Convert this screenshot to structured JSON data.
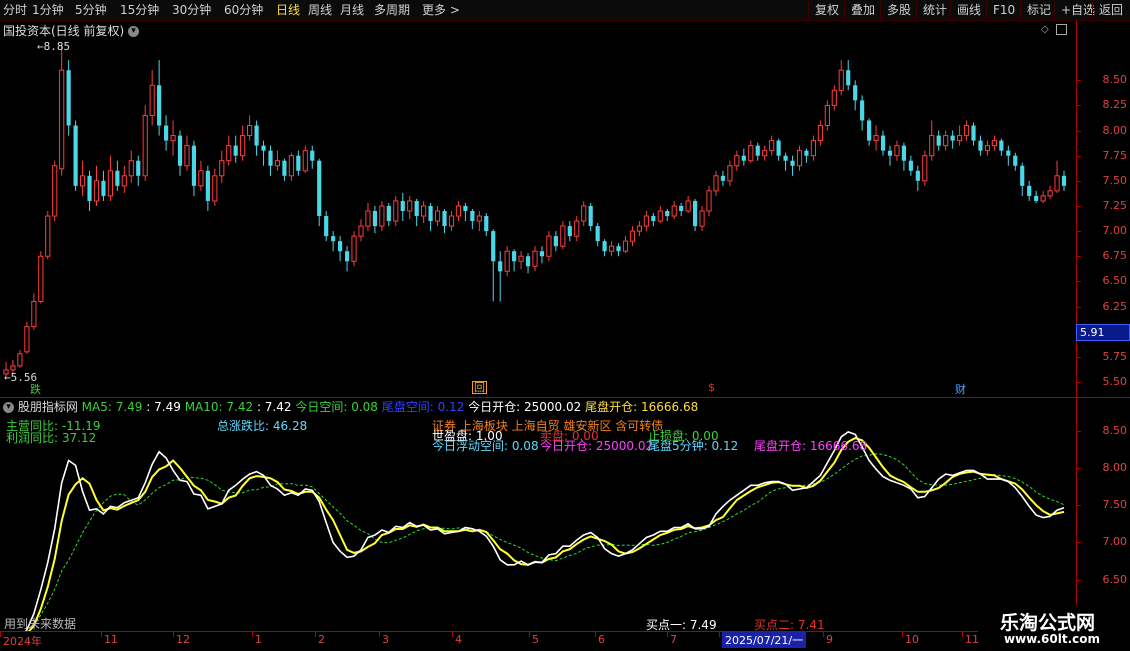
{
  "toolbar": {
    "periods": [
      "分时",
      "1分钟",
      "5分钟",
      "15分钟",
      "30分钟",
      "60分钟",
      "日线",
      "周线",
      "月线",
      "多周期",
      "更多 >"
    ],
    "active_period": "日线",
    "actions": [
      "复权",
      "叠加",
      "多股",
      "统计",
      "画线",
      "F10",
      "标记",
      "+自选",
      "返回"
    ]
  },
  "main": {
    "title": "国投资本(日线 前复权)",
    "high_label": "8.85",
    "low_label": "5.56",
    "current_price": "5.91",
    "yticks": [
      "8.50",
      "8.25",
      "8.00",
      "7.75",
      "7.50",
      "7.25",
      "7.00",
      "6.75",
      "6.50",
      "6.25",
      "6.00",
      "5.75",
      "5.50"
    ],
    "markers": [
      {
        "label": "跌",
        "color": "#3cd03c"
      },
      {
        "label": "回",
        "color": "#f0a020"
      },
      {
        "label": "$",
        "color": "#e03030"
      },
      {
        "label": "财",
        "color": "#4aa0ff"
      }
    ],
    "candles": [
      [
        5.62,
        5.58,
        5.7,
        5.55
      ],
      [
        5.66,
        5.62,
        5.72,
        5.58
      ],
      [
        5.78,
        5.66,
        5.82,
        5.64
      ],
      [
        6.05,
        5.8,
        6.1,
        5.78
      ],
      [
        6.3,
        6.05,
        6.38,
        6.02
      ],
      [
        6.75,
        6.3,
        6.8,
        6.28
      ],
      [
        7.15,
        6.75,
        7.2,
        6.72
      ],
      [
        7.65,
        7.15,
        7.7,
        7.1
      ],
      [
        8.6,
        7.62,
        8.85,
        7.55
      ],
      [
        8.05,
        8.6,
        8.7,
        7.95
      ],
      [
        7.45,
        8.05,
        8.1,
        7.4
      ],
      [
        7.55,
        7.45,
        7.7,
        7.35
      ],
      [
        7.3,
        7.55,
        7.6,
        7.2
      ],
      [
        7.5,
        7.3,
        7.65,
        7.25
      ],
      [
        7.35,
        7.5,
        7.6,
        7.3
      ],
      [
        7.6,
        7.35,
        7.75,
        7.3
      ],
      [
        7.45,
        7.6,
        7.7,
        7.4
      ],
      [
        7.55,
        7.45,
        7.65,
        7.38
      ],
      [
        7.7,
        7.55,
        7.8,
        7.48
      ],
      [
        7.55,
        7.7,
        7.75,
        7.45
      ],
      [
        8.15,
        7.55,
        8.25,
        7.5
      ],
      [
        8.45,
        8.15,
        8.6,
        8.05
      ],
      [
        8.05,
        8.45,
        8.7,
        7.95
      ],
      [
        7.9,
        8.05,
        8.15,
        7.8
      ],
      [
        7.95,
        7.9,
        8.1,
        7.75
      ],
      [
        7.65,
        7.95,
        8.0,
        7.55
      ],
      [
        7.85,
        7.65,
        7.95,
        7.6
      ],
      [
        7.45,
        7.85,
        7.9,
        7.35
      ],
      [
        7.6,
        7.45,
        7.7,
        7.4
      ],
      [
        7.3,
        7.6,
        7.65,
        7.2
      ],
      [
        7.55,
        7.3,
        7.62,
        7.25
      ],
      [
        7.7,
        7.55,
        7.8,
        7.48
      ],
      [
        7.85,
        7.7,
        7.95,
        7.65
      ],
      [
        7.75,
        7.85,
        7.95,
        7.68
      ],
      [
        7.95,
        7.75,
        8.05,
        7.7
      ],
      [
        8.05,
        7.95,
        8.15,
        7.9
      ],
      [
        7.85,
        8.05,
        8.1,
        7.75
      ],
      [
        7.8,
        7.85,
        7.9,
        7.65
      ],
      [
        7.65,
        7.8,
        7.85,
        7.55
      ],
      [
        7.7,
        7.65,
        7.8,
        7.6
      ],
      [
        7.55,
        7.7,
        7.72,
        7.5
      ],
      [
        7.75,
        7.55,
        7.78,
        7.5
      ],
      [
        7.6,
        7.75,
        7.8,
        7.55
      ],
      [
        7.8,
        7.6,
        7.85,
        7.58
      ],
      [
        7.7,
        7.8,
        7.85,
        7.62
      ],
      [
        7.15,
        7.7,
        7.72,
        7.05
      ],
      [
        6.95,
        7.15,
        7.2,
        6.9
      ],
      [
        6.9,
        6.95,
        7.0,
        6.8
      ],
      [
        6.8,
        6.9,
        6.95,
        6.7
      ],
      [
        6.7,
        6.8,
        6.85,
        6.6
      ],
      [
        6.95,
        6.7,
        7.0,
        6.65
      ],
      [
        7.05,
        6.95,
        7.12,
        6.9
      ],
      [
        7.2,
        7.05,
        7.28,
        7.0
      ],
      [
        7.05,
        7.2,
        7.25,
        6.98
      ],
      [
        7.25,
        7.05,
        7.3,
        7.0
      ],
      [
        7.1,
        7.25,
        7.28,
        7.05
      ],
      [
        7.3,
        7.1,
        7.35,
        7.05
      ],
      [
        7.2,
        7.3,
        7.38,
        7.1
      ],
      [
        7.3,
        7.2,
        7.35,
        7.12
      ],
      [
        7.15,
        7.3,
        7.32,
        7.05
      ],
      [
        7.25,
        7.15,
        7.3,
        7.08
      ],
      [
        7.1,
        7.25,
        7.28,
        7.0
      ],
      [
        7.2,
        7.1,
        7.25,
        7.05
      ],
      [
        7.05,
        7.2,
        7.22,
        6.98
      ],
      [
        7.15,
        7.05,
        7.2,
        7.0
      ],
      [
        7.25,
        7.15,
        7.3,
        7.1
      ],
      [
        7.2,
        7.25,
        7.28,
        7.1
      ],
      [
        7.1,
        7.2,
        7.22,
        7.02
      ],
      [
        7.15,
        7.1,
        7.2,
        7.0
      ],
      [
        7.0,
        7.15,
        7.18,
        6.95
      ],
      [
        6.7,
        7.0,
        7.02,
        6.3
      ],
      [
        6.6,
        6.7,
        6.8,
        6.3
      ],
      [
        6.8,
        6.6,
        6.85,
        6.55
      ],
      [
        6.7,
        6.8,
        6.82,
        6.6
      ],
      [
        6.75,
        6.7,
        6.8,
        6.62
      ],
      [
        6.65,
        6.75,
        6.78,
        6.58
      ],
      [
        6.8,
        6.65,
        6.85,
        6.6
      ],
      [
        6.75,
        6.8,
        6.85,
        6.68
      ],
      [
        6.95,
        6.75,
        7.0,
        6.7
      ],
      [
        6.85,
        6.95,
        7.0,
        6.8
      ],
      [
        7.05,
        6.85,
        7.1,
        6.82
      ],
      [
        6.95,
        7.05,
        7.1,
        6.9
      ],
      [
        7.1,
        6.95,
        7.15,
        6.9
      ],
      [
        7.25,
        7.1,
        7.3,
        7.05
      ],
      [
        7.05,
        7.25,
        7.28,
        7.0
      ],
      [
        6.9,
        7.05,
        7.08,
        6.85
      ],
      [
        6.8,
        6.9,
        6.92,
        6.75
      ],
      [
        6.85,
        6.8,
        6.9,
        6.75
      ],
      [
        6.8,
        6.85,
        6.88,
        6.75
      ],
      [
        6.9,
        6.8,
        6.95,
        6.78
      ],
      [
        7.0,
        6.9,
        7.05,
        6.85
      ],
      [
        7.05,
        7.0,
        7.1,
        6.95
      ],
      [
        7.15,
        7.05,
        7.2,
        7.0
      ],
      [
        7.1,
        7.15,
        7.18,
        7.05
      ],
      [
        7.2,
        7.1,
        7.25,
        7.08
      ],
      [
        7.15,
        7.2,
        7.22,
        7.1
      ],
      [
        7.25,
        7.15,
        7.3,
        7.12
      ],
      [
        7.2,
        7.25,
        7.28,
        7.15
      ],
      [
        7.3,
        7.2,
        7.35,
        7.18
      ],
      [
        7.05,
        7.3,
        7.32,
        7.0
      ],
      [
        7.2,
        7.05,
        7.25,
        7.0
      ],
      [
        7.4,
        7.2,
        7.45,
        7.15
      ],
      [
        7.55,
        7.4,
        7.6,
        7.35
      ],
      [
        7.5,
        7.55,
        7.6,
        7.45
      ],
      [
        7.65,
        7.5,
        7.7,
        7.45
      ],
      [
        7.75,
        7.65,
        7.8,
        7.6
      ],
      [
        7.7,
        7.75,
        7.82,
        7.65
      ],
      [
        7.85,
        7.7,
        7.9,
        7.68
      ],
      [
        7.75,
        7.85,
        7.88,
        7.7
      ],
      [
        7.8,
        7.75,
        7.85,
        7.7
      ],
      [
        7.9,
        7.8,
        7.95,
        7.75
      ],
      [
        7.75,
        7.9,
        7.92,
        7.7
      ],
      [
        7.7,
        7.75,
        7.78,
        7.6
      ],
      [
        7.65,
        7.7,
        7.75,
        7.55
      ],
      [
        7.8,
        7.65,
        7.85,
        7.6
      ],
      [
        7.75,
        7.8,
        7.82,
        7.68
      ],
      [
        7.9,
        7.75,
        7.95,
        7.7
      ],
      [
        8.05,
        7.9,
        8.1,
        7.85
      ],
      [
        8.25,
        8.05,
        8.3,
        8.0
      ],
      [
        8.4,
        8.25,
        8.45,
        8.2
      ],
      [
        8.6,
        8.4,
        8.7,
        8.35
      ],
      [
        8.45,
        8.6,
        8.7,
        8.4
      ],
      [
        8.3,
        8.45,
        8.5,
        8.2
      ],
      [
        8.1,
        8.3,
        8.35,
        8.0
      ],
      [
        7.9,
        8.1,
        8.12,
        7.85
      ],
      [
        7.95,
        7.9,
        8.05,
        7.8
      ],
      [
        7.8,
        7.95,
        8.0,
        7.75
      ],
      [
        7.75,
        7.8,
        7.85,
        7.65
      ],
      [
        7.85,
        7.75,
        7.9,
        7.7
      ],
      [
        7.7,
        7.85,
        7.88,
        7.6
      ],
      [
        7.6,
        7.7,
        7.75,
        7.55
      ],
      [
        7.5,
        7.6,
        7.65,
        7.4
      ],
      [
        7.75,
        7.5,
        7.8,
        7.45
      ],
      [
        7.95,
        7.75,
        8.1,
        7.7
      ],
      [
        7.85,
        7.95,
        8.0,
        7.8
      ],
      [
        7.95,
        7.85,
        8.0,
        7.8
      ],
      [
        7.9,
        7.95,
        8.0,
        7.82
      ],
      [
        7.95,
        7.9,
        8.05,
        7.85
      ],
      [
        8.05,
        7.95,
        8.1,
        7.9
      ],
      [
        7.9,
        8.05,
        8.08,
        7.85
      ],
      [
        7.8,
        7.9,
        7.95,
        7.75
      ],
      [
        7.85,
        7.8,
        7.9,
        7.75
      ],
      [
        7.9,
        7.85,
        7.95,
        7.8
      ],
      [
        7.8,
        7.9,
        7.92,
        7.75
      ],
      [
        7.75,
        7.8,
        7.85,
        7.65
      ],
      [
        7.65,
        7.75,
        7.78,
        7.6
      ],
      [
        7.45,
        7.65,
        7.68,
        7.35
      ],
      [
        7.35,
        7.45,
        7.5,
        7.3
      ],
      [
        7.3,
        7.35,
        7.4,
        7.28
      ],
      [
        7.35,
        7.3,
        7.4,
        7.28
      ],
      [
        7.4,
        7.35,
        7.45,
        7.32
      ],
      [
        7.55,
        7.4,
        7.7,
        7.38
      ],
      [
        7.45,
        7.55,
        7.6,
        7.4
      ]
    ]
  },
  "indicator": {
    "name": "股朋指标网",
    "ma5_label": "MA5: 7.49",
    "ma5_value": ": 7.49",
    "ma10_label": "MA10: 7.42",
    "ma10_value": ": 7.42",
    "jinri_kongjian": "今日空间: 0.08",
    "weipan_kongjian": "尾盘空间: 0.12",
    "jinri_kaicang": "今日开仓: 25000.02",
    "weipan_kaicang": "尾盘开仓: 16666.68",
    "zhuying_tongbi": "主营同比: -11.19",
    "lirun_tongbi": "利润同比: 37.12",
    "zong_zhangdie": "总涨跌比: 46.28",
    "concepts": "证券 上海板块 上海自贸 雄安新区 含可转债",
    "overlay_a": "世盈盘: 1.00",
    "overlay_b": "卖盘: 0.00",
    "overlay_c": "止损盘: 0.00",
    "jinri_fudong": "今日浮动空间: 0.08",
    "jinri_kaicang2": "今日开仓: 25000.02",
    "weipan_5min": "尾盘5分钟: 0.12",
    "weipan_kaicang2": "尾盘开仓: 16666.68",
    "future_note": "用到未来数据",
    "buy1": "买点一: 7.49",
    "buy2": "买点二: 7.41",
    "yticks": [
      "8.50",
      "8.00",
      "7.50",
      "7.00",
      "6.50",
      "6.00"
    ]
  },
  "timeaxis": {
    "labels": [
      "2024年",
      "11",
      "12",
      "1",
      "2",
      "3",
      "4",
      "5",
      "6",
      "7",
      "2025/07/21/一",
      "9",
      "10",
      "11"
    ],
    "highlight": "2025/07/21/一"
  },
  "watermark": {
    "title": "乐淘公式网",
    "url": "www.60lt.com"
  }
}
